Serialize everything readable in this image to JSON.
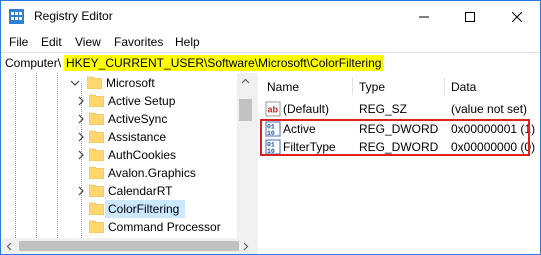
{
  "window": {
    "title": "Registry Editor",
    "minimize_icon": "minimize-icon",
    "maximize_icon": "maximize-icon",
    "close_icon": "close-icon"
  },
  "menu": {
    "items": [
      "File",
      "Edit",
      "View",
      "Favorites",
      "Help"
    ]
  },
  "address": {
    "prefix": "Computer\\",
    "path": "HKEY_CURRENT_USER\\Software\\Microsoft\\ColorFiltering",
    "highlight_color": "#ffff00"
  },
  "tree": {
    "items": [
      {
        "label": "Microsoft",
        "expanded": true
      },
      {
        "label": "Active Setup"
      },
      {
        "label": "ActiveSync"
      },
      {
        "label": "Assistance"
      },
      {
        "label": "AuthCookies"
      },
      {
        "label": "Avalon.Graphics"
      },
      {
        "label": "CalendarRT"
      },
      {
        "label": "ColorFiltering",
        "selected": true
      },
      {
        "label": "Command Processor"
      }
    ],
    "selection_color": "#cce8ff",
    "folder_color": "#ffd76e"
  },
  "values": {
    "columns": [
      "Name",
      "Type",
      "Data"
    ],
    "rows": [
      {
        "name": "(Default)",
        "type": "REG_SZ",
        "data": "(value not set)",
        "icon": "string-value-icon"
      },
      {
        "name": "Active",
        "type": "REG_DWORD",
        "data": "0x00000001 (1)",
        "icon": "binary-value-icon"
      },
      {
        "name": "FilterType",
        "type": "REG_DWORD",
        "data": "0x00000000 (0)",
        "icon": "binary-value-icon"
      }
    ],
    "highlight_box_color": "#e0201e"
  }
}
